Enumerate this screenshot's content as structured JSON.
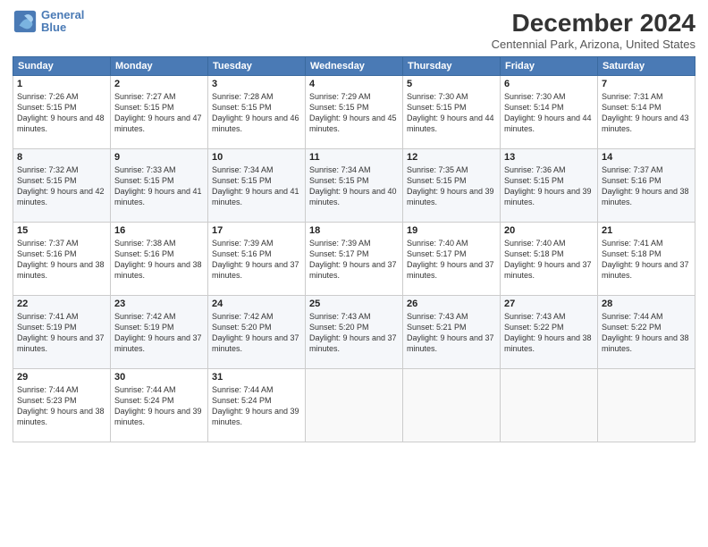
{
  "header": {
    "logo": {
      "line1": "General",
      "line2": "Blue"
    },
    "title": "December 2024",
    "subtitle": "Centennial Park, Arizona, United States"
  },
  "calendar": {
    "weekdays": [
      "Sunday",
      "Monday",
      "Tuesday",
      "Wednesday",
      "Thursday",
      "Friday",
      "Saturday"
    ],
    "weeks": [
      [
        null,
        null,
        null,
        null,
        null,
        null,
        null
      ]
    ],
    "days": [
      {
        "num": "1",
        "dow": 0,
        "sunrise": "Sunrise: 7:26 AM",
        "sunset": "Sunset: 5:15 PM",
        "daylight": "Daylight: 9 hours and 48 minutes."
      },
      {
        "num": "2",
        "dow": 1,
        "sunrise": "Sunrise: 7:27 AM",
        "sunset": "Sunset: 5:15 PM",
        "daylight": "Daylight: 9 hours and 47 minutes."
      },
      {
        "num": "3",
        "dow": 2,
        "sunrise": "Sunrise: 7:28 AM",
        "sunset": "Sunset: 5:15 PM",
        "daylight": "Daylight: 9 hours and 46 minutes."
      },
      {
        "num": "4",
        "dow": 3,
        "sunrise": "Sunrise: 7:29 AM",
        "sunset": "Sunset: 5:15 PM",
        "daylight": "Daylight: 9 hours and 45 minutes."
      },
      {
        "num": "5",
        "dow": 4,
        "sunrise": "Sunrise: 7:30 AM",
        "sunset": "Sunset: 5:15 PM",
        "daylight": "Daylight: 9 hours and 44 minutes."
      },
      {
        "num": "6",
        "dow": 5,
        "sunrise": "Sunrise: 7:30 AM",
        "sunset": "Sunset: 5:14 PM",
        "daylight": "Daylight: 9 hours and 44 minutes."
      },
      {
        "num": "7",
        "dow": 6,
        "sunrise": "Sunrise: 7:31 AM",
        "sunset": "Sunset: 5:14 PM",
        "daylight": "Daylight: 9 hours and 43 minutes."
      },
      {
        "num": "8",
        "dow": 0,
        "sunrise": "Sunrise: 7:32 AM",
        "sunset": "Sunset: 5:15 PM",
        "daylight": "Daylight: 9 hours and 42 minutes."
      },
      {
        "num": "9",
        "dow": 1,
        "sunrise": "Sunrise: 7:33 AM",
        "sunset": "Sunset: 5:15 PM",
        "daylight": "Daylight: 9 hours and 41 minutes."
      },
      {
        "num": "10",
        "dow": 2,
        "sunrise": "Sunrise: 7:34 AM",
        "sunset": "Sunset: 5:15 PM",
        "daylight": "Daylight: 9 hours and 41 minutes."
      },
      {
        "num": "11",
        "dow": 3,
        "sunrise": "Sunrise: 7:34 AM",
        "sunset": "Sunset: 5:15 PM",
        "daylight": "Daylight: 9 hours and 40 minutes."
      },
      {
        "num": "12",
        "dow": 4,
        "sunrise": "Sunrise: 7:35 AM",
        "sunset": "Sunset: 5:15 PM",
        "daylight": "Daylight: 9 hours and 39 minutes."
      },
      {
        "num": "13",
        "dow": 5,
        "sunrise": "Sunrise: 7:36 AM",
        "sunset": "Sunset: 5:15 PM",
        "daylight": "Daylight: 9 hours and 39 minutes."
      },
      {
        "num": "14",
        "dow": 6,
        "sunrise": "Sunrise: 7:37 AM",
        "sunset": "Sunset: 5:16 PM",
        "daylight": "Daylight: 9 hours and 38 minutes."
      },
      {
        "num": "15",
        "dow": 0,
        "sunrise": "Sunrise: 7:37 AM",
        "sunset": "Sunset: 5:16 PM",
        "daylight": "Daylight: 9 hours and 38 minutes."
      },
      {
        "num": "16",
        "dow": 1,
        "sunrise": "Sunrise: 7:38 AM",
        "sunset": "Sunset: 5:16 PM",
        "daylight": "Daylight: 9 hours and 38 minutes."
      },
      {
        "num": "17",
        "dow": 2,
        "sunrise": "Sunrise: 7:39 AM",
        "sunset": "Sunset: 5:16 PM",
        "daylight": "Daylight: 9 hours and 37 minutes."
      },
      {
        "num": "18",
        "dow": 3,
        "sunrise": "Sunrise: 7:39 AM",
        "sunset": "Sunset: 5:17 PM",
        "daylight": "Daylight: 9 hours and 37 minutes."
      },
      {
        "num": "19",
        "dow": 4,
        "sunrise": "Sunrise: 7:40 AM",
        "sunset": "Sunset: 5:17 PM",
        "daylight": "Daylight: 9 hours and 37 minutes."
      },
      {
        "num": "20",
        "dow": 5,
        "sunrise": "Sunrise: 7:40 AM",
        "sunset": "Sunset: 5:18 PM",
        "daylight": "Daylight: 9 hours and 37 minutes."
      },
      {
        "num": "21",
        "dow": 6,
        "sunrise": "Sunrise: 7:41 AM",
        "sunset": "Sunset: 5:18 PM",
        "daylight": "Daylight: 9 hours and 37 minutes."
      },
      {
        "num": "22",
        "dow": 0,
        "sunrise": "Sunrise: 7:41 AM",
        "sunset": "Sunset: 5:19 PM",
        "daylight": "Daylight: 9 hours and 37 minutes."
      },
      {
        "num": "23",
        "dow": 1,
        "sunrise": "Sunrise: 7:42 AM",
        "sunset": "Sunset: 5:19 PM",
        "daylight": "Daylight: 9 hours and 37 minutes."
      },
      {
        "num": "24",
        "dow": 2,
        "sunrise": "Sunrise: 7:42 AM",
        "sunset": "Sunset: 5:20 PM",
        "daylight": "Daylight: 9 hours and 37 minutes."
      },
      {
        "num": "25",
        "dow": 3,
        "sunrise": "Sunrise: 7:43 AM",
        "sunset": "Sunset: 5:20 PM",
        "daylight": "Daylight: 9 hours and 37 minutes."
      },
      {
        "num": "26",
        "dow": 4,
        "sunrise": "Sunrise: 7:43 AM",
        "sunset": "Sunset: 5:21 PM",
        "daylight": "Daylight: 9 hours and 37 minutes."
      },
      {
        "num": "27",
        "dow": 5,
        "sunrise": "Sunrise: 7:43 AM",
        "sunset": "Sunset: 5:22 PM",
        "daylight": "Daylight: 9 hours and 38 minutes."
      },
      {
        "num": "28",
        "dow": 6,
        "sunrise": "Sunrise: 7:44 AM",
        "sunset": "Sunset: 5:22 PM",
        "daylight": "Daylight: 9 hours and 38 minutes."
      },
      {
        "num": "29",
        "dow": 0,
        "sunrise": "Sunrise: 7:44 AM",
        "sunset": "Sunset: 5:23 PM",
        "daylight": "Daylight: 9 hours and 38 minutes."
      },
      {
        "num": "30",
        "dow": 1,
        "sunrise": "Sunrise: 7:44 AM",
        "sunset": "Sunset: 5:24 PM",
        "daylight": "Daylight: 9 hours and 39 minutes."
      },
      {
        "num": "31",
        "dow": 2,
        "sunrise": "Sunrise: 7:44 AM",
        "sunset": "Sunset: 5:24 PM",
        "daylight": "Daylight: 9 hours and 39 minutes."
      }
    ]
  }
}
